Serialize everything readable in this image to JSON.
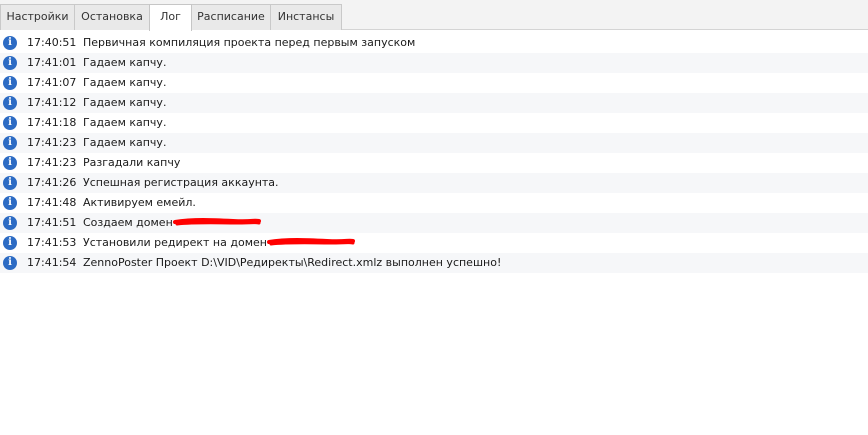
{
  "tabs": [
    {
      "label": "Настройки",
      "active": false
    },
    {
      "label": "Остановка",
      "active": false
    },
    {
      "label": "Лог",
      "active": true
    },
    {
      "label": "Расписание",
      "active": false
    },
    {
      "label": "Инстансы",
      "active": false
    }
  ],
  "log": {
    "icon": "info-icon",
    "icon_color": "#2c6bc4",
    "redaction_color": "#ff0000",
    "entries": [
      {
        "time": "17:40:51",
        "message": "Первичная компиляция проекта перед первым запуском"
      },
      {
        "time": "17:41:01",
        "message": "Гадаем капчу."
      },
      {
        "time": "17:41:07",
        "message": "Гадаем капчу."
      },
      {
        "time": "17:41:12",
        "message": "Гадаем капчу."
      },
      {
        "time": "17:41:18",
        "message": "Гадаем капчу."
      },
      {
        "time": "17:41:23",
        "message": "Гадаем капчу."
      },
      {
        "time": "17:41:23",
        "message": "Разгадали капчу"
      },
      {
        "time": "17:41:26",
        "message": "Успешная регистрация аккаунта."
      },
      {
        "time": "17:41:48",
        "message": "Активируем емейл."
      },
      {
        "time": "17:41:51",
        "message": "Создаем домен",
        "redacted": true
      },
      {
        "time": "17:41:53",
        "message": "Установили редирект на домен",
        "redacted": true
      },
      {
        "time": "17:41:54",
        "message": "ZennoPoster Проект D:\\VID\\Редиректы\\Redirect.xmlz выполнен успешно!"
      }
    ]
  }
}
